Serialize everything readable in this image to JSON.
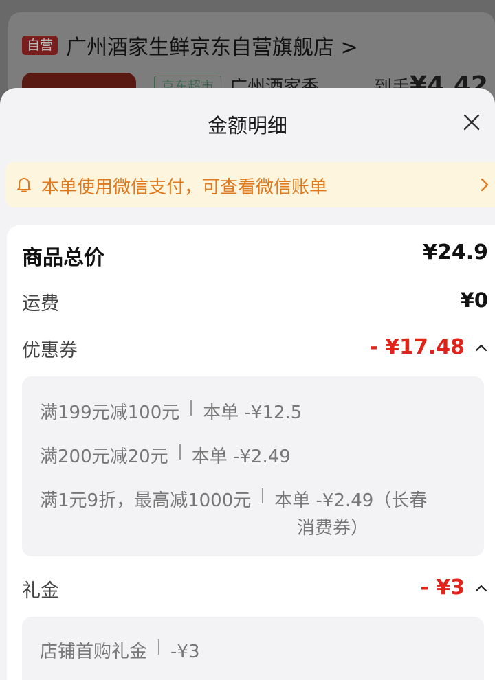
{
  "background": {
    "store_badge": "自营",
    "store_name": "广州酒家生鲜京东自营旗舰店 >",
    "product_tag": "京东超市",
    "product_name": "广州酒家香",
    "price_prefix": "到手",
    "price_value": "¥4.42"
  },
  "sheet": {
    "title": "金额明细",
    "notice": "本单使用微信支付，可查看微信账单"
  },
  "summary": {
    "total_label": "商品总价",
    "total_value": "¥24.9",
    "shipping_label": "运费",
    "shipping_value": "¥0",
    "coupon_label": "优惠券",
    "coupon_value": "- ¥17.48",
    "coupons": [
      {
        "rule": "满199元减100元",
        "amount": "本单 -¥12.5"
      },
      {
        "rule": "满200元减20元",
        "amount": "本单 -¥2.49"
      },
      {
        "rule": "满1元9折，最高减1000元",
        "amount": "本单 -¥2.49（长春",
        "amount_line2": "消费券）"
      }
    ],
    "gift_label": "礼金",
    "gift_value": "- ¥3",
    "gifts": [
      {
        "rule": "店铺首购礼金",
        "amount": "-¥3"
      }
    ]
  },
  "colors": {
    "accent_red": "#e2231a",
    "notice_orange": "#e0791e",
    "notice_bg": "#fdf5de"
  },
  "icons": [
    "bell-icon",
    "chevron-right-icon",
    "close-icon",
    "chevron-up-icon"
  ]
}
